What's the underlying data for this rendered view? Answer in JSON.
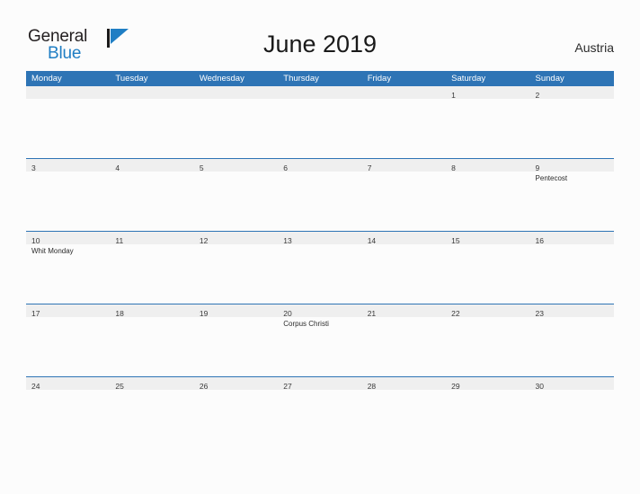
{
  "brand": {
    "name_part1": "General",
    "name_part2": "Blue",
    "flag_icon": "triangle-flag-icon",
    "accent_color": "#1f7ec4"
  },
  "header": {
    "title": "June 2019",
    "country": "Austria"
  },
  "colors": {
    "header_blue": "#2e74b5",
    "date_band_gray": "#efefef",
    "page_background": "#fcfcfc",
    "text_dark": "#2b2b2b"
  },
  "calendar": {
    "month": "June",
    "year": "2019",
    "weekday_headers": [
      "Monday",
      "Tuesday",
      "Wednesday",
      "Thursday",
      "Friday",
      "Saturday",
      "Sunday"
    ],
    "weeks": [
      [
        {
          "day": "",
          "events": []
        },
        {
          "day": "",
          "events": []
        },
        {
          "day": "",
          "events": []
        },
        {
          "day": "",
          "events": []
        },
        {
          "day": "",
          "events": []
        },
        {
          "day": "1",
          "events": []
        },
        {
          "day": "2",
          "events": []
        }
      ],
      [
        {
          "day": "3",
          "events": []
        },
        {
          "day": "4",
          "events": []
        },
        {
          "day": "5",
          "events": []
        },
        {
          "day": "6",
          "events": []
        },
        {
          "day": "7",
          "events": []
        },
        {
          "day": "8",
          "events": []
        },
        {
          "day": "9",
          "events": [
            "Pentecost"
          ]
        }
      ],
      [
        {
          "day": "10",
          "events": [
            "Whit Monday"
          ]
        },
        {
          "day": "11",
          "events": []
        },
        {
          "day": "12",
          "events": []
        },
        {
          "day": "13",
          "events": []
        },
        {
          "day": "14",
          "events": []
        },
        {
          "day": "15",
          "events": []
        },
        {
          "day": "16",
          "events": []
        }
      ],
      [
        {
          "day": "17",
          "events": []
        },
        {
          "day": "18",
          "events": []
        },
        {
          "day": "19",
          "events": []
        },
        {
          "day": "20",
          "events": [
            "Corpus Christi"
          ]
        },
        {
          "day": "21",
          "events": []
        },
        {
          "day": "22",
          "events": []
        },
        {
          "day": "23",
          "events": []
        }
      ],
      [
        {
          "day": "24",
          "events": []
        },
        {
          "day": "25",
          "events": []
        },
        {
          "day": "26",
          "events": []
        },
        {
          "day": "27",
          "events": []
        },
        {
          "day": "28",
          "events": []
        },
        {
          "day": "29",
          "events": []
        },
        {
          "day": "30",
          "events": []
        }
      ]
    ]
  }
}
